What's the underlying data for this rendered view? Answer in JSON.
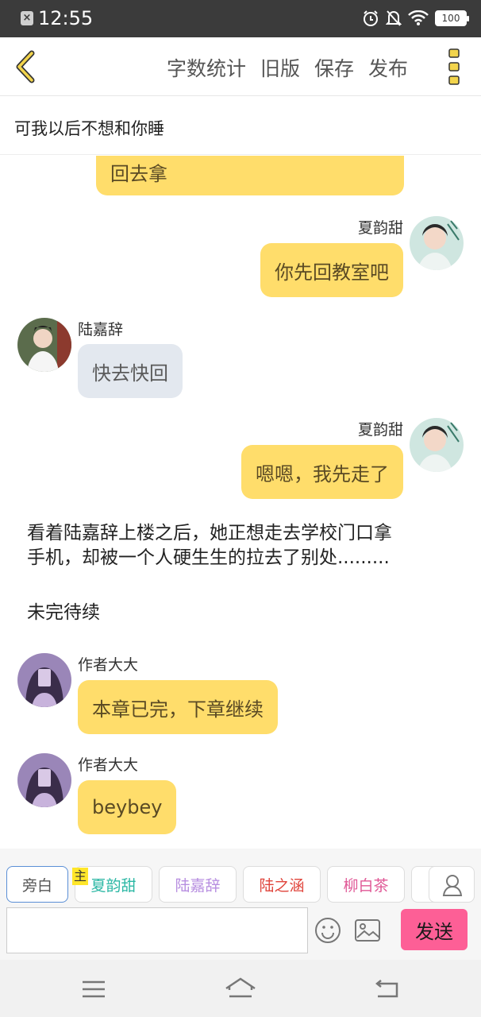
{
  "status": {
    "time": "12:55",
    "battery": "100"
  },
  "topbar": {
    "actions": [
      "字数统计",
      "旧版",
      "保存",
      "发布"
    ]
  },
  "chapter": {
    "title": "可我以后不想和你睡"
  },
  "messages": {
    "m0": {
      "text": "回去拿"
    },
    "m1": {
      "name": "夏韵甜",
      "text": "你先回教室吧"
    },
    "m2": {
      "name": "陆嘉辞",
      "text": "快去快回"
    },
    "m3": {
      "name": "夏韵甜",
      "text": "嗯嗯，我先走了"
    },
    "narration1": {
      "line1": "看着陆嘉辞上楼之后，她正想走去学校门口拿",
      "line2": "手机，却被一个人硬生生的拉去了别处........."
    },
    "narration2": {
      "text": "未完待续"
    },
    "m4": {
      "name": "作者大大",
      "text": "本章已完，下章继续"
    },
    "m5": {
      "name": "作者大大",
      "text": "beybey"
    }
  },
  "roles": {
    "narrator": "旁白",
    "main_tag": "主",
    "items": [
      {
        "label": "夏韵甜",
        "color": "#2bb7a4"
      },
      {
        "label": "陆嘉辞",
        "color": "#b78ee0"
      },
      {
        "label": "陆之涵",
        "color": "#e0453c"
      },
      {
        "label": "柳白茶",
        "color": "#e05896"
      }
    ]
  },
  "composer": {
    "placeholder": "",
    "send_label": "发送"
  },
  "colors": {
    "bubble_yellow": "#ffdd6b",
    "bubble_gray": "#e3e8ef",
    "send": "#fd5f96",
    "accent": "#f2c230"
  },
  "icons": [
    "back-arrow-icon",
    "more-vertical-icon",
    "emoji-icon",
    "image-icon",
    "profile-icon",
    "menu-icon",
    "home-icon",
    "return-icon",
    "alarm-icon",
    "mute-icon",
    "wifi-icon"
  ]
}
